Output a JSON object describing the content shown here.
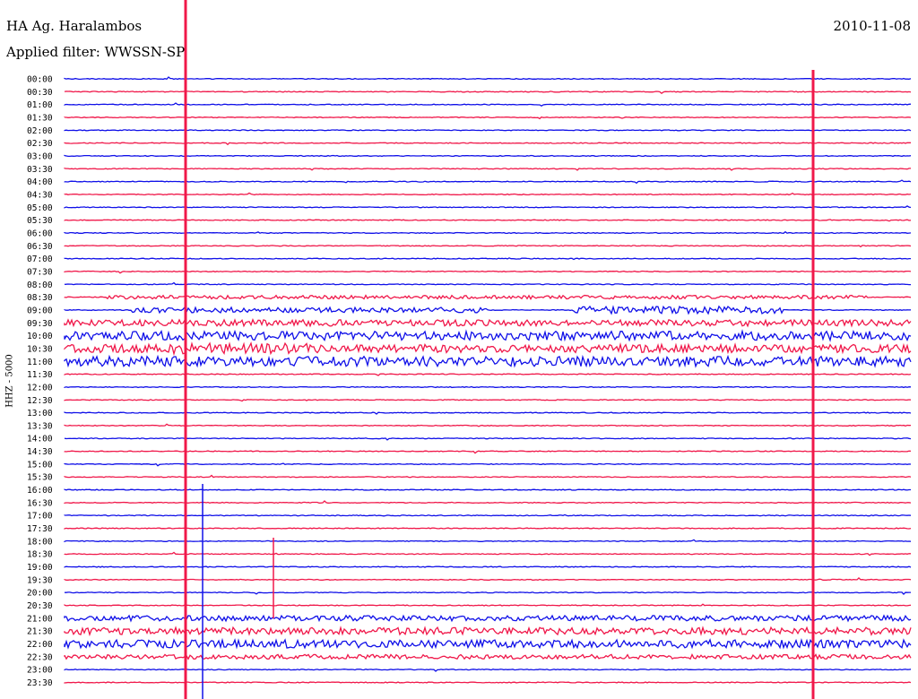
{
  "header": {
    "station": "HA Ag. Haralambos",
    "filter": "Applied filter: WWSSN-SP",
    "date": "2010-11-08"
  },
  "colors": {
    "trace_a": "#1010e8",
    "trace_b": "#f0184a",
    "text": "#000000",
    "background": "#ffffff"
  },
  "chart_data": {
    "type": "helicorder",
    "ylabel": "HHZ - 5000",
    "y_ticks": [
      "00:00",
      "00:30",
      "01:00",
      "01:30",
      "02:00",
      "02:30",
      "03:00",
      "03:30",
      "04:00",
      "04:30",
      "05:00",
      "05:30",
      "06:00",
      "06:30",
      "07:00",
      "07:30",
      "08:00",
      "08:30",
      "09:00",
      "09:30",
      "10:00",
      "10:30",
      "11:00",
      "11:30",
      "12:00",
      "12:30",
      "13:00",
      "13:30",
      "14:00",
      "14:30",
      "15:00",
      "15:30",
      "16:00",
      "16:30",
      "17:00",
      "17:30",
      "18:00",
      "18:30",
      "19:00",
      "19:30",
      "20:00",
      "20:30",
      "21:00",
      "21:30",
      "22:00",
      "22:30",
      "23:00",
      "23:30"
    ],
    "line_duration_minutes": 30,
    "trace_colors_alternate": [
      "blue",
      "red"
    ],
    "grid": false
  }
}
